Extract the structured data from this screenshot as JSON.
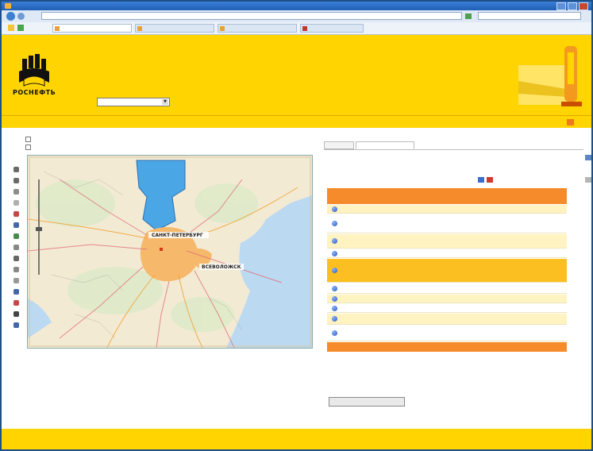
{
  "browser": {
    "title": "",
    "address": "",
    "search_placeholder": "",
    "tabs": [
      {
        "label": ""
      },
      {
        "label": ""
      },
      {
        "label": ""
      },
      {
        "label": ""
      }
    ],
    "tools_label": ""
  },
  "header": {
    "brand": "РОСНЕФТЬ",
    "title": "",
    "line1": "",
    "line2": "",
    "select_label": "",
    "select_value": ""
  },
  "subbar": {
    "left_link": "",
    "right_link1": "",
    "right_link2": ""
  },
  "left": {
    "link1": "",
    "link2": "",
    "map_labels": {
      "city1": "САНКТ-ПЕТЕРБУРГ",
      "city2": "ВСЕВОЛОЖСК"
    },
    "caption": ""
  },
  "right": {
    "tabs": [
      {
        "label": ""
      },
      {
        "label": ""
      }
    ],
    "link": "",
    "legend_label": "",
    "table": {
      "col1": "",
      "col2": "",
      "col3": "",
      "rows": [
        {
          "no": "",
          "desc": "",
          "dt": ""
        },
        {
          "no": "",
          "desc": "",
          "dt": ""
        },
        {
          "no": "",
          "desc": "",
          "dt": ""
        },
        {
          "no": "",
          "desc": "",
          "dt": ""
        },
        {
          "no": "",
          "desc": "",
          "dt": ""
        },
        {
          "no": "",
          "desc": "",
          "dt": ""
        },
        {
          "no": "",
          "desc": "",
          "dt": ""
        },
        {
          "no": "",
          "desc": "",
          "dt": ""
        },
        {
          "no": "",
          "desc": "",
          "dt": ""
        },
        {
          "no": "",
          "desc": "",
          "dt": ""
        }
      ],
      "footer": ""
    },
    "export_button": ""
  },
  "footer": {
    "line1": "",
    "line2": ""
  },
  "colors": {
    "header_yellow": "#ffd400",
    "table_orange": "#f58b2a",
    "link_blue": "#2a5bb7",
    "accent_red": "#d43b0b"
  }
}
